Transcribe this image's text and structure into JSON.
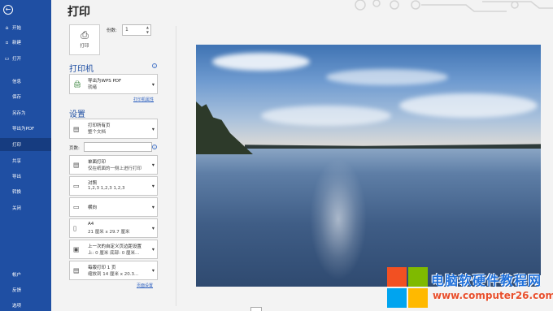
{
  "sidebar": {
    "back_icon": "arrow-left-icon",
    "items": [
      {
        "label": "开始",
        "icon": "home-icon"
      },
      {
        "label": "新建",
        "icon": "new-doc-icon"
      },
      {
        "label": "打开",
        "icon": "folder-icon"
      },
      {
        "label": "信息"
      },
      {
        "label": "保存"
      },
      {
        "label": "另存为"
      },
      {
        "label": "导出为PDF"
      },
      {
        "label": "打印",
        "active": true
      },
      {
        "label": "共享"
      },
      {
        "label": "导出"
      },
      {
        "label": "转换"
      },
      {
        "label": "关闭"
      }
    ],
    "bottom_items": [
      {
        "label": "帐户"
      },
      {
        "label": "反馈"
      },
      {
        "label": "选项"
      }
    ],
    "color": "#1f4fa3"
  },
  "main": {
    "title": "打印",
    "print_button_label": "打印",
    "copies_label": "份数:",
    "copies_value": "1",
    "printer": {
      "section_title": "打印机",
      "name": "导出为WPS PDF",
      "status": "就绪",
      "properties_link": "打印机属性"
    },
    "settings": {
      "section_title": "设置",
      "range": {
        "line1": "打印所有页",
        "line2": "整个文档"
      },
      "pages_label": "页数:",
      "sides": {
        "line1": "单面打印",
        "line2": "仅在纸面的一侧上进行打印"
      },
      "collate": {
        "line1": "对照",
        "line2": "1,2,3    1,2,3    1,2,3"
      },
      "orientation": {
        "line1": "横向"
      },
      "paper": {
        "line1": "A4",
        "line2": "21 厘米 x 29.7 厘米"
      },
      "margins": {
        "line1": "上一次的自定义页边距设置",
        "line2": "上: 0 厘米 底部: 0 厘米..."
      },
      "pages_per_sheet": {
        "line1": "每版打印 1 页",
        "line2": "缩放到 14 厘米 x 20.3..."
      },
      "page_setup_link": "页面设置"
    }
  },
  "watermark": {
    "text_cn": "电脑软硬件教程网",
    "text_url": "www.computer26.com"
  }
}
